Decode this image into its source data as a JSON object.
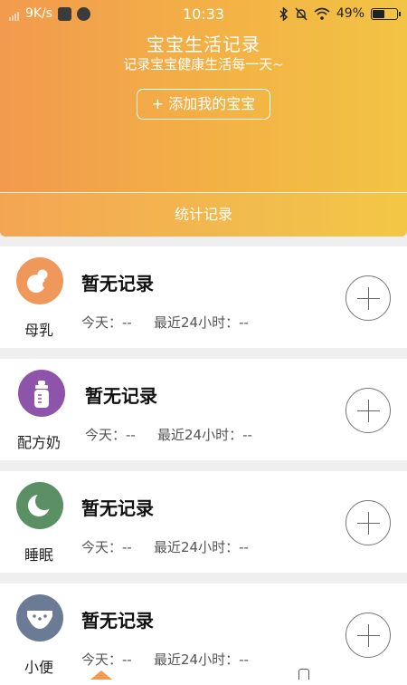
{
  "status_bar": {
    "speed": "9K/s",
    "time": "10:33",
    "battery": "49%"
  },
  "header": {
    "title": "宝宝生活记录",
    "subtitle": "记录宝宝健康生活每一天~",
    "add_button": "+ 添加我的宝宝"
  },
  "stats_button": "统计记录",
  "cards": [
    {
      "label": "母乳",
      "status": "暂无记录",
      "today": "今天：--",
      "recent": "最近24小时：--",
      "color": "#f0975b",
      "icon": "breastfeeding-icon"
    },
    {
      "label": "配方奶",
      "status": "暂无记录",
      "today": "今天：--",
      "recent": "最近24小时：--",
      "color": "#8e54a9",
      "icon": "bottle-icon"
    },
    {
      "label": "睡眠",
      "status": "暂无记录",
      "today": "今天：--",
      "recent": "最近24小时：--",
      "color": "#5a9064",
      "icon": "moon-icon"
    },
    {
      "label": "小便",
      "status": "暂无记录",
      "today": "今天：--",
      "recent": "最近24小时：--",
      "color": "#6b7b95",
      "icon": "diaper-icon"
    }
  ]
}
